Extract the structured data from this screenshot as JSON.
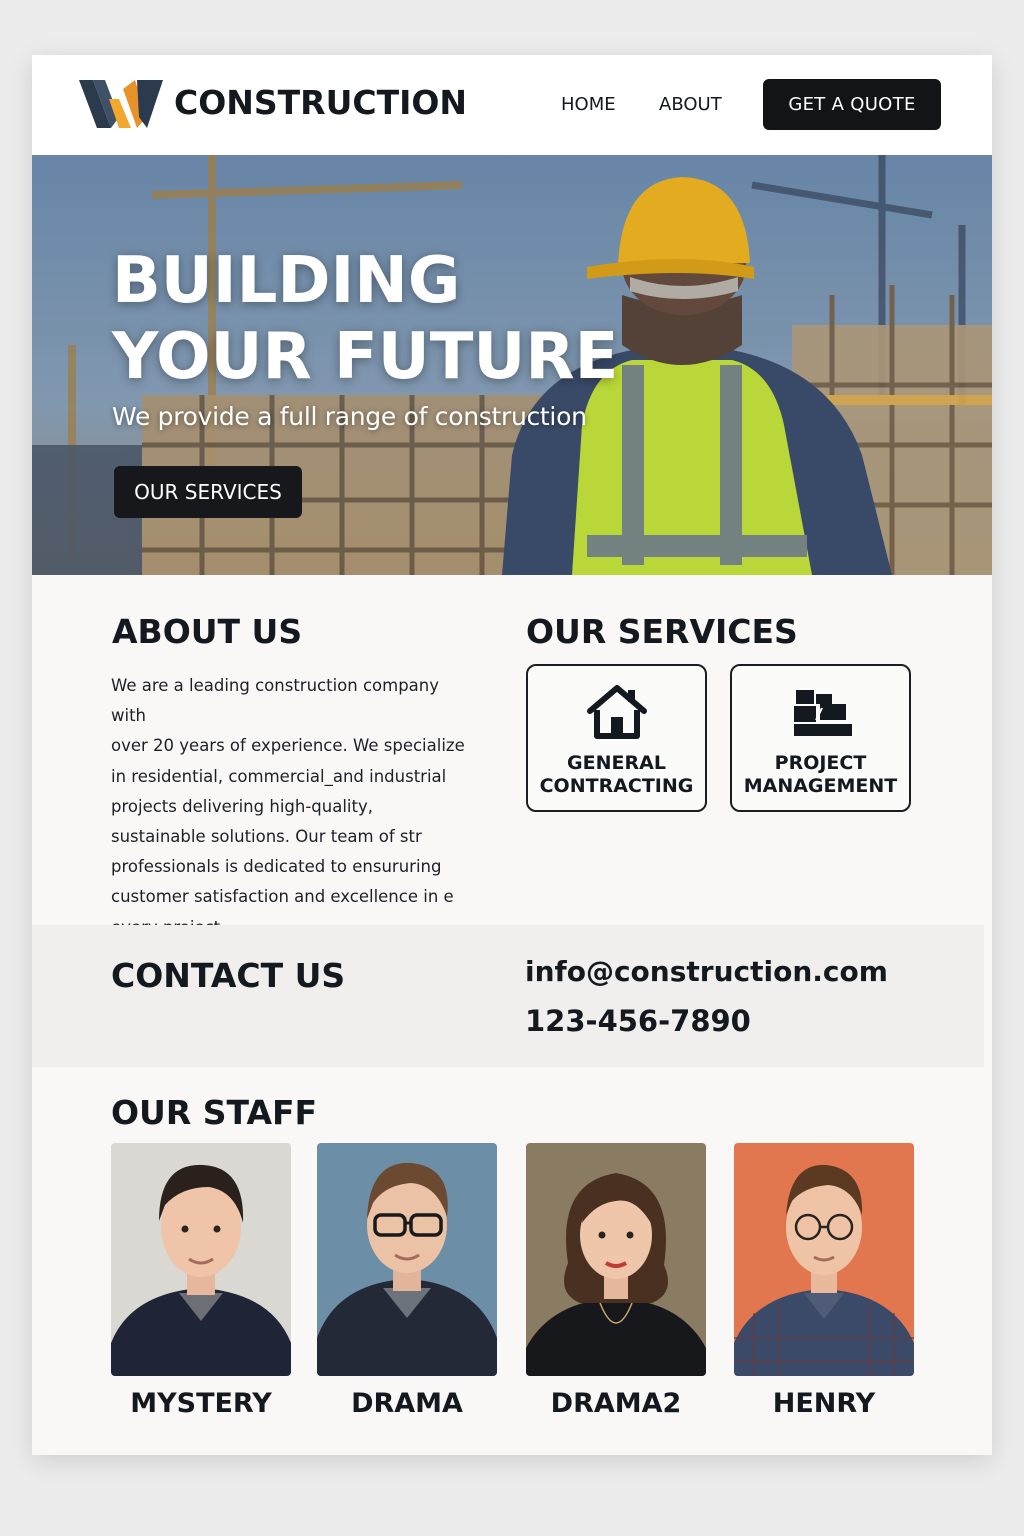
{
  "header": {
    "brand": "CONSTRUCTION",
    "nav": [
      "HOME",
      "ABOUT"
    ],
    "cta": "GET A QUOTE"
  },
  "hero": {
    "title_line1": "BUILDING",
    "title_line2": "YOUR FUTURE",
    "subtitle": "We provide a full range of construction",
    "button": "OUR SERVICES"
  },
  "about": {
    "title": "ABOUT US",
    "lines": [
      "We are a leading construction company with",
      "over 20 years of experience. We specialize",
      "in residential, commercial_and industrial",
      "projects  delivering high-quality,",
      "sustainable solutions. Our team of  str",
      "professionals is dedicated to ensururing",
      "customer satisfaction and excellence in e",
      "every project."
    ]
  },
  "services": {
    "title": "OUR SERVICES",
    "items": [
      {
        "line1": "GENERAL",
        "line2": "CONTRACTING",
        "icon": "house-icon"
      },
      {
        "line1": "PROJECT",
        "line2": "MANAGEMENT",
        "icon": "blocks-icon"
      }
    ]
  },
  "contact": {
    "title": "CONTACT US",
    "email": "info@construction.com",
    "phone": "123-456-7890"
  },
  "staff": {
    "title": "OUR STAFF",
    "members": [
      {
        "name": "MYSTERY",
        "bg": "#d9d8d3"
      },
      {
        "name": "DRAMA",
        "bg": "#6c8ea6"
      },
      {
        "name": "DRAMA2",
        "bg": "#8a7b63"
      },
      {
        "name": "HENRY",
        "bg": "#e2774f"
      }
    ]
  },
  "colors": {
    "dark": "#121417",
    "accent_orange": "#f2a72e",
    "logo_navy": "#2b3a4d",
    "vest": "#c8e83a",
    "helmet": "#f4b81f"
  }
}
